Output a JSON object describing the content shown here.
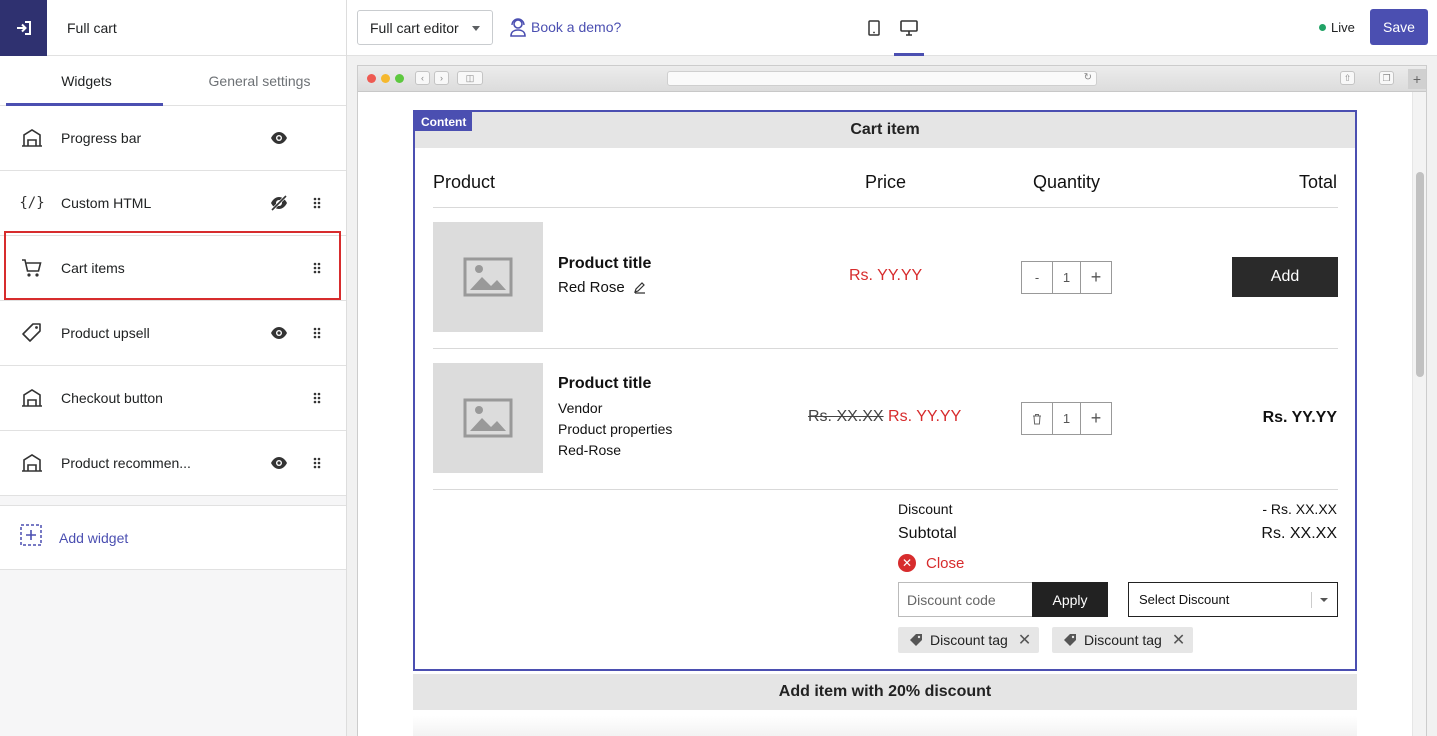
{
  "sidebar": {
    "title": "Full cart",
    "tabs": [
      {
        "label": "Widgets"
      },
      {
        "label": "General settings"
      }
    ],
    "widgets": [
      {
        "label": "Progress bar"
      },
      {
        "label": "Custom HTML"
      },
      {
        "label": "Cart items"
      },
      {
        "label": "Product upsell"
      },
      {
        "label": "Checkout button"
      },
      {
        "label": "Product recommen..."
      }
    ],
    "add_widget_label": "Add widget"
  },
  "topbar": {
    "editor_label": "Full cart editor",
    "demo_label": "Book a demo?",
    "live_label": "Live",
    "save_label": "Save",
    "accent_color": "#4b4fb1"
  },
  "cart": {
    "content_tag": "Content",
    "section_title": "Cart item",
    "columns": {
      "product": "Product",
      "price": "Price",
      "quantity": "Quantity",
      "total": "Total"
    },
    "items": [
      {
        "title": "Product title",
        "variant": "Red Rose",
        "price": "Rs. YY.YY",
        "quantity": "1",
        "decrement": "-",
        "increment": "+",
        "action": "Add"
      },
      {
        "title": "Product title",
        "vendor": "Vendor",
        "properties": "Product properties",
        "variant": "Red-Rose",
        "compare_price": "Rs. XX.XX",
        "price": "Rs. YY.YY",
        "quantity": "1",
        "increment": "+",
        "total": "Rs. YY.YY"
      }
    ],
    "summary": {
      "discount_label": "Discount",
      "discount_value": "- Rs. XX.XX",
      "subtotal_label": "Subtotal",
      "subtotal_value": "Rs. XX.XX",
      "close_label": "Close",
      "discount_placeholder": "Discount code",
      "apply_label": "Apply",
      "select_discount": "Select Discount",
      "tags": [
        "Discount tag",
        "Discount tag"
      ]
    },
    "next_section_title": "Add item with 20% discount"
  }
}
